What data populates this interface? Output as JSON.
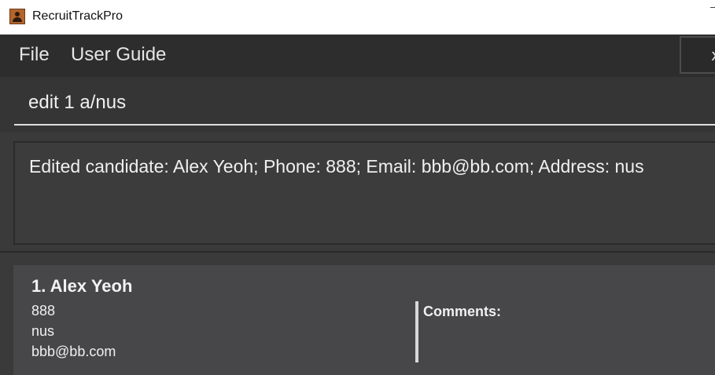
{
  "window": {
    "title": "RecruitTrackPro",
    "icon": "person-icon"
  },
  "menubar": {
    "file": "File",
    "user_guide": "User Guide",
    "right_glyph": "x"
  },
  "command": {
    "value": "edit 1 a/nus"
  },
  "result": {
    "message": "Edited candidate: Alex Yeoh; Phone: 888; Email: bbb@bb.com; Address: nus"
  },
  "candidates": [
    {
      "index_name": "1. Alex Yeoh",
      "phone": "888",
      "address": "nus",
      "email": "bbb@bb.com",
      "comments_label": "Comments:"
    }
  ],
  "colors": {
    "background": "#3a3a3b",
    "menubar": "#2d2d2e",
    "card": "#47474a",
    "text": "#f0f0f0"
  }
}
